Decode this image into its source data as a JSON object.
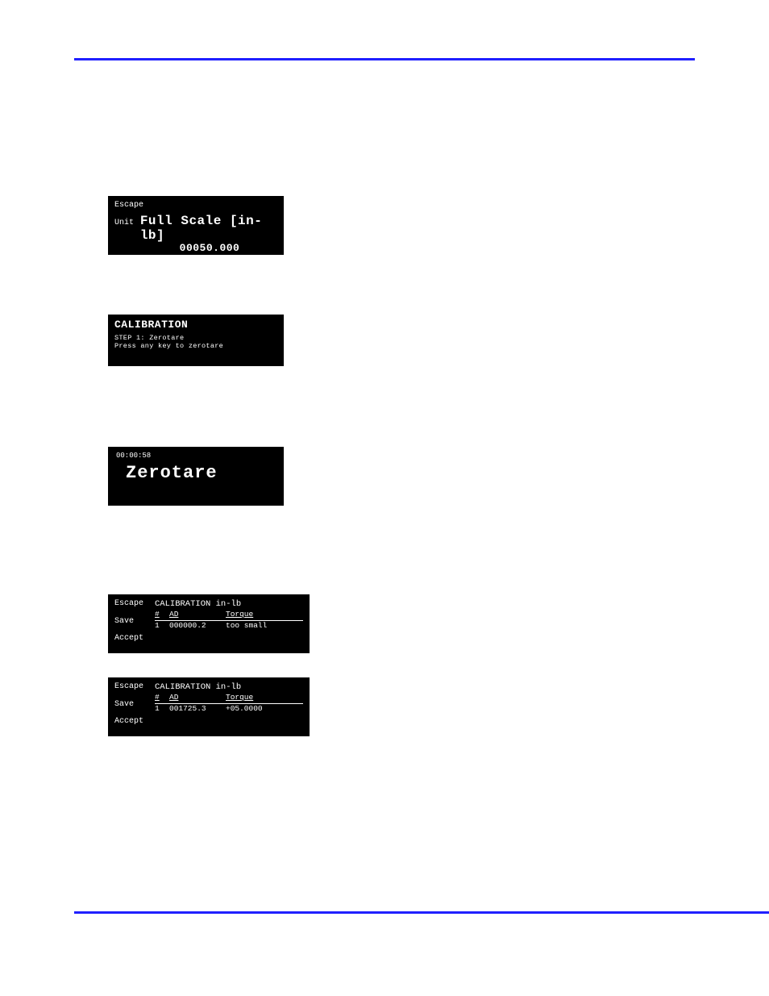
{
  "screen1": {
    "escape": "Escape",
    "unit": "Unit",
    "title": "Full Scale [in-lb]",
    "value": "00050.000"
  },
  "screen2": {
    "title": "CALIBRATION",
    "line1": "STEP 1: Zerotare",
    "line2": "Press any key to zerotare"
  },
  "screen3": {
    "time": "00:00:58",
    "title": "Zerotare"
  },
  "tableScreens": {
    "escape": "Escape",
    "save": "Save",
    "accept": "Accept",
    "title": "CALIBRATION in-lb",
    "head_num": "#",
    "head_ad": "AD",
    "head_torque": "Torque"
  },
  "tbl1": {
    "num": "1",
    "ad": "000000.2",
    "torque": "too small"
  },
  "tbl2": {
    "num": "1",
    "ad": "001725.3",
    "torque": "+05.0000"
  }
}
